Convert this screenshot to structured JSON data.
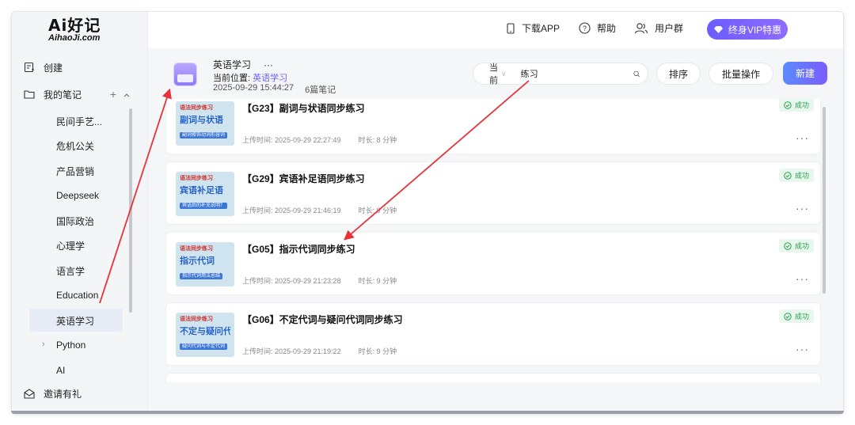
{
  "logo": {
    "main": "Ai好记",
    "sub": "AihaoJi.com"
  },
  "sidebar": {
    "create": "创建",
    "my_notes": "我的笔记",
    "folders": [
      {
        "label": "民间手艺..."
      },
      {
        "label": "危机公关"
      },
      {
        "label": "产品营销"
      },
      {
        "label": "Deepseek"
      },
      {
        "label": "国际政治"
      },
      {
        "label": "心理学"
      },
      {
        "label": "语言学"
      },
      {
        "label": "Education"
      },
      {
        "label": "英语学习"
      },
      {
        "label": "Python"
      },
      {
        "label": "AI"
      }
    ],
    "invite": "邀请有礼"
  },
  "topbar": {
    "download": "下载APP",
    "help": "帮助",
    "users": "用户群",
    "vip": "终身VIP特惠"
  },
  "folder": {
    "title": "英语学习",
    "more": "···",
    "path_label": "当前位置:",
    "path_value": "英语学习",
    "created": "2025-09-29 15:44:27",
    "count": "6篇笔记"
  },
  "search": {
    "scope": "当前",
    "query": "练习"
  },
  "actions": {
    "sort": "排序",
    "batch": "批量操作",
    "new": "新建"
  },
  "notes": [
    {
      "title": "【G23】副词与状语同步练习",
      "uploaded": "上传时间: 2025-09-29 22:27:49",
      "duration": "时长: 8 分钟",
      "status": "成功",
      "thumb": {
        "top": "语法同步练习",
        "main": "副词与状语",
        "tag": "副词修饰动词形容词"
      }
    },
    {
      "title": "【G29】宾语补足语同步练习",
      "uploaded": "上传时间: 2025-09-29 21:46:19",
      "duration": "时长: 9 分钟",
      "status": "成功",
      "thumb": {
        "top": "语法同步练习",
        "main": "宾语补足语",
        "tag": "宾语后的补充说明？"
      }
    },
    {
      "title": "【G05】指示代词同步练习",
      "uploaded": "上传时间: 2025-09-29 21:23:28",
      "duration": "时长: 9 分钟",
      "status": "成功",
      "thumb": {
        "top": "语法同步练习",
        "main": "指示代词",
        "tag": "指示代词用法总结"
      }
    },
    {
      "title": "【G06】不定代词与疑问代词同步练习",
      "uploaded": "上传时间: 2025-09-29 21:19:22",
      "duration": "时长: 9 分钟",
      "status": "成功",
      "thumb": {
        "top": "语法同步练习",
        "main": "不定与疑问代词",
        "tag": "疑问代词与不定代词"
      }
    }
  ],
  "colors": {
    "accent": "#6a5cff",
    "success": "#27a048",
    "annotation_arrow": "#e8333b"
  }
}
